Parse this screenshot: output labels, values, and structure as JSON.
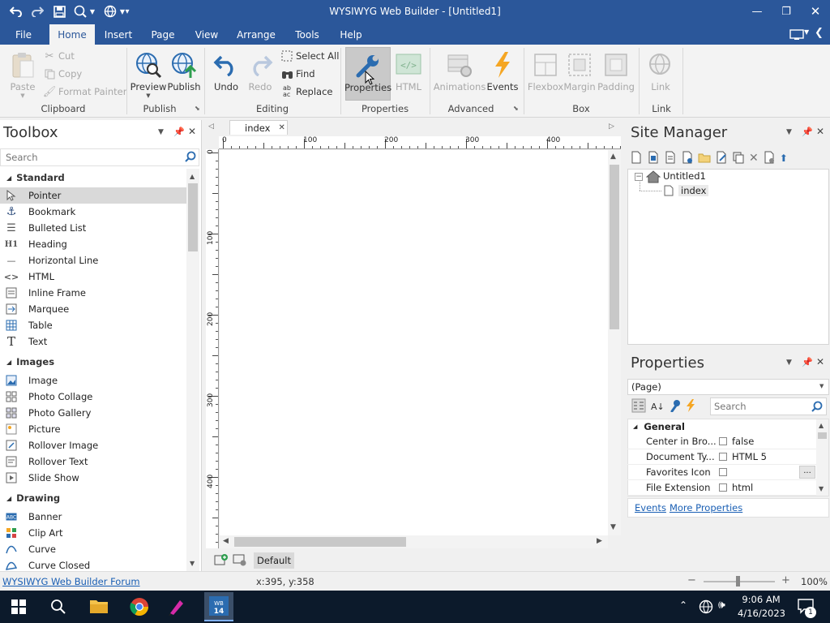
{
  "window": {
    "title": "WYSIWYG Web Builder - [Untitled1]"
  },
  "ribbon": {
    "tabs": [
      "File",
      "Home",
      "Insert",
      "Page",
      "View",
      "Arrange",
      "Tools",
      "Help"
    ],
    "active_tab": "Home",
    "clipboard": {
      "paste": "Paste",
      "cut": "Cut",
      "copy": "Copy",
      "format_painter": "Format Painter",
      "group": "Clipboard"
    },
    "publish": {
      "preview": "Preview",
      "publish": "Publish",
      "group": "Publish"
    },
    "editing": {
      "undo": "Undo",
      "redo": "Redo",
      "select_all": "Select All",
      "find": "Find",
      "replace": "Replace",
      "group": "Editing"
    },
    "properties": {
      "properties": "Properties",
      "html": "HTML",
      "group": "Properties"
    },
    "advanced": {
      "animations": "Animations",
      "events": "Events",
      "group": "Advanced"
    },
    "box": {
      "flexbox": "Flexbox",
      "margin": "Margin",
      "padding": "Padding",
      "group": "Box"
    },
    "link": {
      "link": "Link",
      "group": "Link"
    }
  },
  "toolbox": {
    "title": "Toolbox",
    "search_placeholder": "Search",
    "categories": [
      {
        "name": "Standard",
        "items": [
          "Pointer",
          "Bookmark",
          "Bulleted List",
          "Heading",
          "Horizontal Line",
          "HTML",
          "Inline Frame",
          "Marquee",
          "Table",
          "Text"
        ]
      },
      {
        "name": "Images",
        "items": [
          "Image",
          "Photo Collage",
          "Photo Gallery",
          "Picture",
          "Rollover Image",
          "Rollover Text",
          "Slide Show"
        ]
      },
      {
        "name": "Drawing",
        "items": [
          "Banner",
          "Clip Art",
          "Curve",
          "Curve Closed"
        ]
      }
    ]
  },
  "document": {
    "tab": "index",
    "ruler_h": [
      "0",
      "100",
      "200",
      "300",
      "400"
    ],
    "ruler_v": [
      "0",
      "100",
      "200",
      "300",
      "400"
    ],
    "layer": "Default"
  },
  "site_manager": {
    "title": "Site Manager",
    "root": "Untitled1",
    "page": "index"
  },
  "properties_panel": {
    "title": "Properties",
    "selector": "(Page)",
    "search_placeholder": "Search",
    "category": "General",
    "rows": [
      {
        "name": "Center in Bro...",
        "value": "false"
      },
      {
        "name": "Document Ty...",
        "value": "HTML 5"
      },
      {
        "name": "Favorites Icon",
        "value": ""
      },
      {
        "name": "File Extension",
        "value": "html"
      }
    ],
    "links": {
      "events": "Events",
      "more": "More Properties"
    }
  },
  "statusbar": {
    "forum_link": "WYSIWYG Web Builder Forum",
    "coords": "x:395, y:358",
    "zoom": "100%"
  },
  "taskbar": {
    "time": "9:06 AM",
    "date": "4/16/2023",
    "notification_count": "1"
  },
  "colors": {
    "accent": "#2b579a",
    "ribbon_bg": "#f3f3f3",
    "taskbar": "#0c1a2b",
    "link": "#1a5fb4"
  }
}
